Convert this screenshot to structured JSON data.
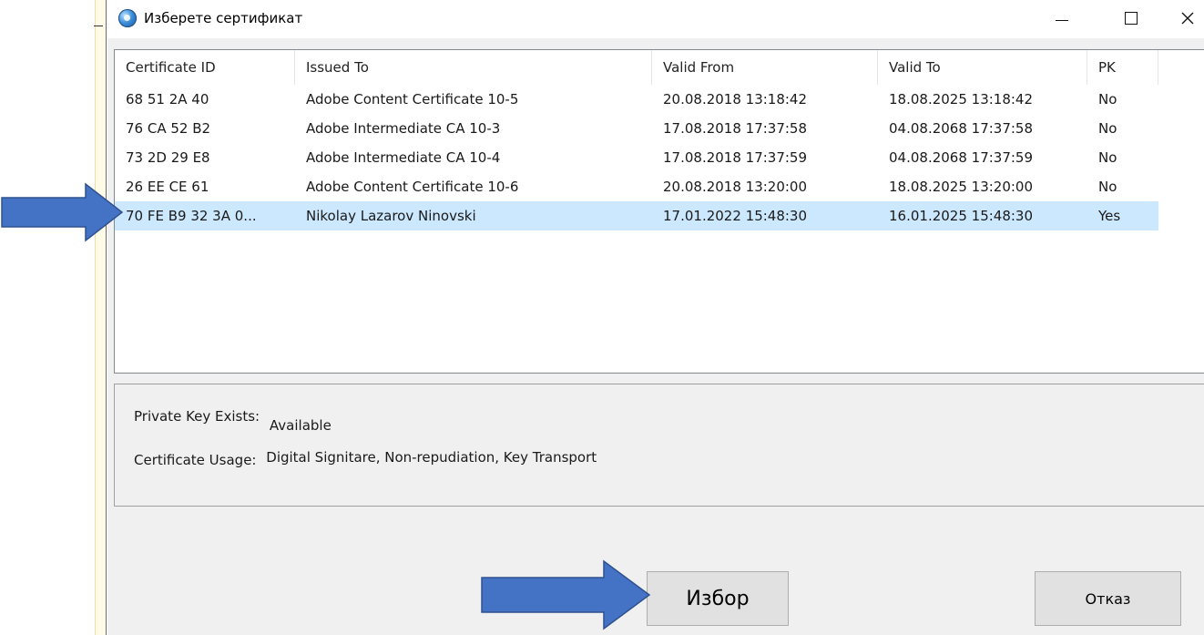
{
  "window": {
    "title": "Изберете сертификат",
    "icon": "certificate-globe-icon",
    "controls": [
      "minimize-icon",
      "maximize-icon",
      "close-icon"
    ]
  },
  "table": {
    "columns": [
      "Certificate ID",
      "Issued To",
      "Valid From",
      "Valid To",
      "PK"
    ],
    "rows": [
      [
        "68 51 2A 40",
        "Adobe Content Certificate 10-5",
        "20.08.2018 13:18:42",
        "18.08.2025 13:18:42",
        "No"
      ],
      [
        "76 CA 52 B2",
        "Adobe Intermediate CA 10-3",
        "17.08.2018 17:37:58",
        "04.08.2068 17:37:58",
        "No"
      ],
      [
        "73 2D 29 E8",
        "Adobe Intermediate CA 10-4",
        "17.08.2018 17:37:59",
        "04.08.2068 17:37:59",
        "No"
      ],
      [
        "26 EE CE 61",
        "Adobe Content Certificate 10-6",
        "20.08.2018 13:20:00",
        "18.08.2025 13:20:00",
        "No"
      ],
      [
        "70 FE B9 32 3A 0...",
        "Nikolay Lazarov Ninovski",
        "17.01.2022 15:48:30",
        "16.01.2025 15:48:30",
        "Yes"
      ]
    ],
    "selected_row": 4,
    "selection_color": "#cce8ff"
  },
  "details": {
    "private_key_label": "Private Key Exists:",
    "private_key_value": "Available",
    "usage_label": "Certificate Usage:",
    "usage_value": "Digital Signitare, Non-repudiation, Key Transport"
  },
  "buttons": {
    "select_label": "Избор",
    "cancel_label": "Отказ"
  },
  "annotations": {
    "arrow_color": "#4472c4",
    "arrow_border": "#2f528f"
  }
}
